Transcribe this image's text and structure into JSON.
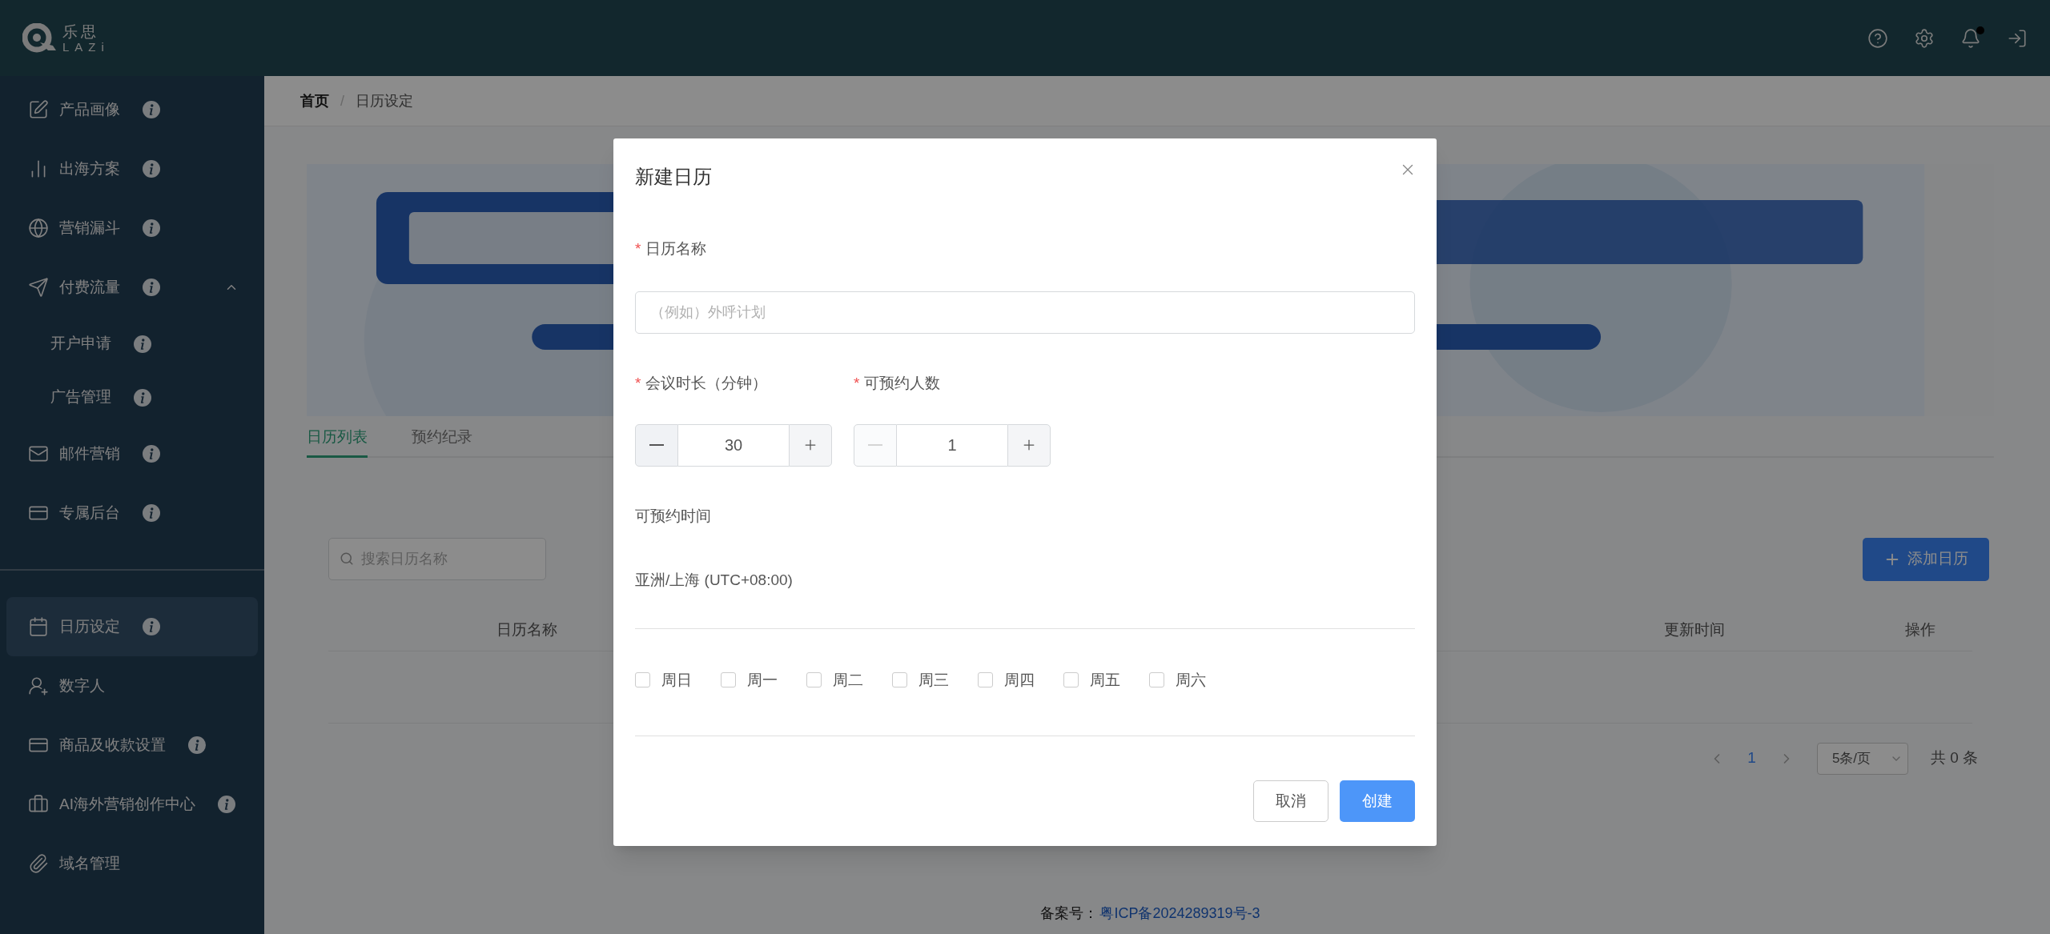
{
  "header": {
    "logo": {
      "cn": "乐思",
      "en": "LAZi"
    },
    "notification_dot": true
  },
  "sidebar": {
    "items": [
      {
        "label": "产品画像",
        "info": true,
        "selected": false
      },
      {
        "label": "出海方案",
        "info": true,
        "selected": false
      },
      {
        "label": "营销漏斗",
        "info": true,
        "selected": false
      },
      {
        "label": "付费流量",
        "info": true,
        "selected": false,
        "expanded": true,
        "children": [
          {
            "label": "开户申请",
            "info": true,
            "selected": false
          },
          {
            "label": "广告管理",
            "info": true,
            "selected": false
          }
        ]
      },
      {
        "label": "邮件营销",
        "info": true,
        "selected": false
      },
      {
        "label": "专属后台",
        "info": true,
        "selected": false
      },
      {
        "kind": "divider"
      },
      {
        "label": "日历设定",
        "info": true,
        "selected": true
      },
      {
        "label": "数字人",
        "info": false,
        "selected": false
      },
      {
        "label": "商品及收款设置",
        "info": true,
        "selected": false
      },
      {
        "label": "AI海外营销创作中心",
        "info": true,
        "selected": false
      },
      {
        "label": "域名管理",
        "info": false,
        "selected": false
      }
    ]
  },
  "breadcrumb": [
    "首页",
    "日历设定"
  ],
  "breadcrumb_separator": "/",
  "banner": {
    "kind": "picture"
  },
  "tabs": [
    {
      "label": "日历列表",
      "selected": true
    },
    {
      "label": "预约纪录",
      "selected": false
    }
  ],
  "search": {
    "placeholder": "搜索日历名称"
  },
  "add_button": {
    "label": "添加日历"
  },
  "table": {
    "columns": [
      "日历名称",
      "更新时间",
      "操作"
    ]
  },
  "pagination": {
    "current": "1",
    "page_size": "5条/页",
    "total": "共 0 条"
  },
  "footer": {
    "label": "备案号：",
    "link": "粤ICP备2024289319号-3"
  },
  "dialog": {
    "title": "新建日历",
    "required_mark": "*",
    "name_field": {
      "label": "日历名称",
      "required": true,
      "placeholder": "（例如）外呼计划"
    },
    "steppers": [
      {
        "label": "会议时长（分钟）",
        "required": true,
        "value": "30",
        "minus_disabled": false
      },
      {
        "label": "可预约人数",
        "required": true,
        "value": "1",
        "minus_disabled": true
      }
    ],
    "availability_label": "可预约时间",
    "timezone": "亚洲/上海 (UTC+08:00)",
    "weekdays": [
      {
        "label": "周日",
        "checked": false
      },
      {
        "label": "周一",
        "checked": false
      },
      {
        "label": "周二",
        "checked": false
      },
      {
        "label": "周三",
        "checked": false
      },
      {
        "label": "周四",
        "checked": false
      },
      {
        "label": "周五",
        "checked": false
      },
      {
        "label": "周六",
        "checked": false
      }
    ],
    "buttons": [
      {
        "label": "取消",
        "kind": "secondary"
      },
      {
        "label": "创建",
        "kind": "primary"
      }
    ]
  }
}
